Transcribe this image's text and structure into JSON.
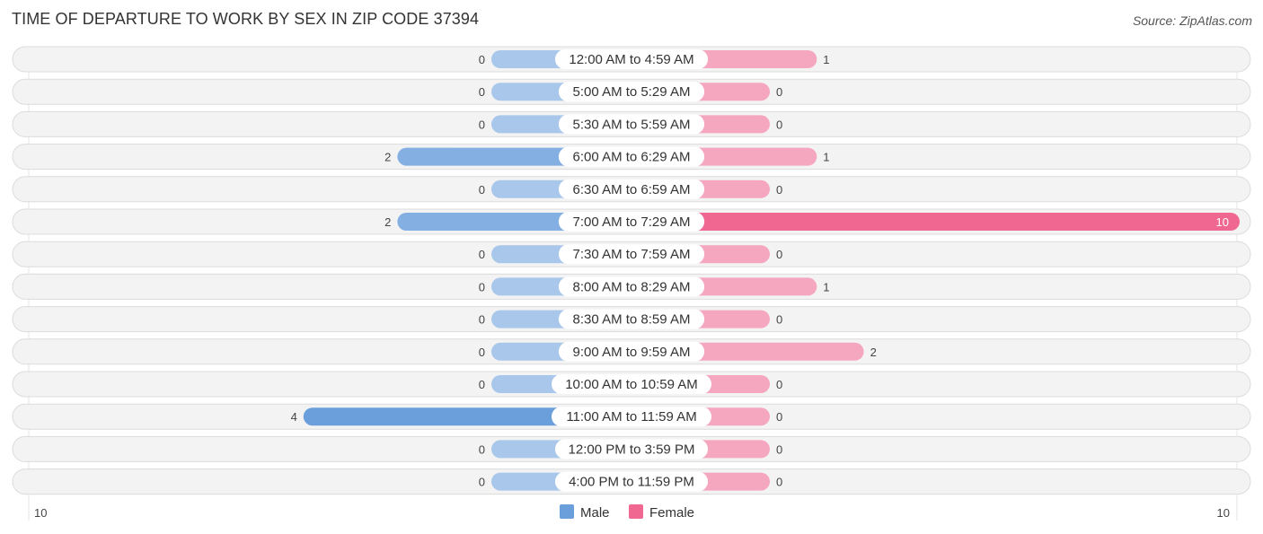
{
  "header": {
    "title": "TIME OF DEPARTURE TO WORK BY SEX IN ZIP CODE 37394",
    "source": "Source: ZipAtlas.com"
  },
  "colors": {
    "male": "#6a9fdb",
    "male_light": "#a9c7ea",
    "female": "#f06891",
    "female_light": "#f5a7c0"
  },
  "chart_data": {
    "type": "bar",
    "orientation": "horizontal-diverging",
    "title": "TIME OF DEPARTURE TO WORK BY SEX IN ZIP CODE 37394",
    "categories": [
      "12:00 AM to 4:59 AM",
      "5:00 AM to 5:29 AM",
      "5:30 AM to 5:59 AM",
      "6:00 AM to 6:29 AM",
      "6:30 AM to 6:59 AM",
      "7:00 AM to 7:29 AM",
      "7:30 AM to 7:59 AM",
      "8:00 AM to 8:29 AM",
      "8:30 AM to 8:59 AM",
      "9:00 AM to 9:59 AM",
      "10:00 AM to 10:59 AM",
      "11:00 AM to 11:59 AM",
      "12:00 PM to 3:59 PM",
      "4:00 PM to 11:59 PM"
    ],
    "series": [
      {
        "name": "Male",
        "values": [
          0,
          0,
          0,
          2,
          0,
          2,
          0,
          0,
          0,
          0,
          0,
          4,
          0,
          0
        ]
      },
      {
        "name": "Female",
        "values": [
          1,
          0,
          0,
          1,
          0,
          10,
          0,
          1,
          0,
          2,
          0,
          0,
          0,
          0
        ]
      }
    ],
    "axis": {
      "left_label": "10",
      "right_label": "10",
      "max": 10
    },
    "legend": {
      "position": "bottom-center",
      "entries": [
        "Male",
        "Female"
      ]
    },
    "xlabel": "",
    "ylabel": ""
  }
}
